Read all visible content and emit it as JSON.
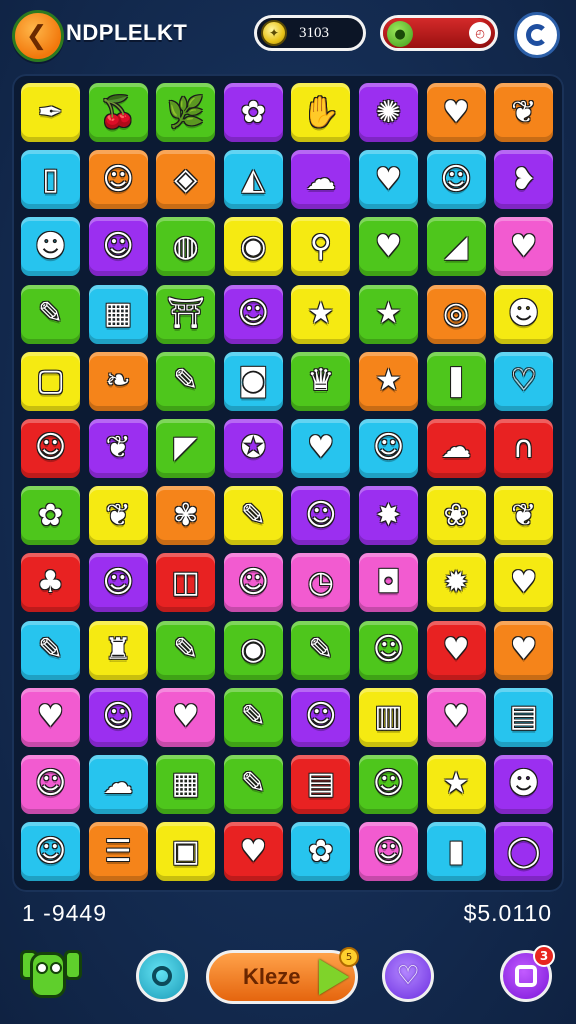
{
  "header": {
    "title": "NDPLELKT",
    "coins": "3103",
    "energy_level_percent": 95,
    "back_icon": "chevron-left-icon",
    "settings_icon": "settings-icon"
  },
  "board": {
    "columns": 8,
    "rows": 12,
    "palette": {
      "Y": "#f5ea12",
      "G": "#4ec61c",
      "P": "#9b2ff0",
      "O": "#f5841a",
      "C": "#27c4ee",
      "R": "#e82222",
      "K": "#f25bd0",
      "B": "#3a9cf0"
    },
    "tiles": [
      [
        {
          "c": "Y",
          "i": "✒"
        },
        {
          "c": "G",
          "i": "🍒"
        },
        {
          "c": "G",
          "i": "🌿"
        },
        {
          "c": "P",
          "i": "✿"
        },
        {
          "c": "Y",
          "i": "✋"
        },
        {
          "c": "P",
          "i": "✺"
        },
        {
          "c": "O",
          "i": "♥"
        },
        {
          "c": "O",
          "i": "❦"
        }
      ],
      [
        {
          "c": "C",
          "i": "▯"
        },
        {
          "c": "O",
          "i": "☺"
        },
        {
          "c": "O",
          "i": "◈"
        },
        {
          "c": "C",
          "i": "◭"
        },
        {
          "c": "P",
          "i": "☁"
        },
        {
          "c": "C",
          "i": "♥"
        },
        {
          "c": "C",
          "i": "☺"
        },
        {
          "c": "P",
          "i": "❥"
        }
      ],
      [
        {
          "c": "C",
          "i": "☻"
        },
        {
          "c": "P",
          "i": "☺"
        },
        {
          "c": "G",
          "i": "◍"
        },
        {
          "c": "Y",
          "i": "◉"
        },
        {
          "c": "Y",
          "i": "⚲"
        },
        {
          "c": "G",
          "i": "♥"
        },
        {
          "c": "G",
          "i": "◢"
        },
        {
          "c": "K",
          "i": "♥"
        }
      ],
      [
        {
          "c": "G",
          "i": "✎"
        },
        {
          "c": "C",
          "i": "▦"
        },
        {
          "c": "G",
          "i": "⛩"
        },
        {
          "c": "P",
          "i": "☺"
        },
        {
          "c": "Y",
          "i": "★"
        },
        {
          "c": "G",
          "i": "★"
        },
        {
          "c": "O",
          "i": "◎"
        },
        {
          "c": "Y",
          "i": "☻"
        }
      ],
      [
        {
          "c": "Y",
          "i": "▢"
        },
        {
          "c": "O",
          "i": "❧"
        },
        {
          "c": "G",
          "i": "✎"
        },
        {
          "c": "C",
          "i": "◙"
        },
        {
          "c": "G",
          "i": "♛"
        },
        {
          "c": "O",
          "i": "★"
        },
        {
          "c": "G",
          "i": "❚"
        },
        {
          "c": "C",
          "i": "♡"
        }
      ],
      [
        {
          "c": "R",
          "i": "☺"
        },
        {
          "c": "P",
          "i": "❦"
        },
        {
          "c": "G",
          "i": "◤"
        },
        {
          "c": "P",
          "i": "✪"
        },
        {
          "c": "C",
          "i": "♥"
        },
        {
          "c": "C",
          "i": "☺"
        },
        {
          "c": "R",
          "i": "☁"
        },
        {
          "c": "R",
          "i": "∩"
        }
      ],
      [
        {
          "c": "G",
          "i": "✿"
        },
        {
          "c": "Y",
          "i": "❦"
        },
        {
          "c": "O",
          "i": "✾"
        },
        {
          "c": "Y",
          "i": "✎"
        },
        {
          "c": "P",
          "i": "☺"
        },
        {
          "c": "P",
          "i": "✸"
        },
        {
          "c": "Y",
          "i": "❀"
        },
        {
          "c": "Y",
          "i": "❦"
        }
      ],
      [
        {
          "c": "R",
          "i": "♣"
        },
        {
          "c": "P",
          "i": "☺"
        },
        {
          "c": "R",
          "i": "◫"
        },
        {
          "c": "K",
          "i": "☺"
        },
        {
          "c": "K",
          "i": "◷"
        },
        {
          "c": "K",
          "i": "◘"
        },
        {
          "c": "Y",
          "i": "✹"
        },
        {
          "c": "Y",
          "i": "♥"
        }
      ],
      [
        {
          "c": "C",
          "i": "✎"
        },
        {
          "c": "Y",
          "i": "♜"
        },
        {
          "c": "G",
          "i": "✎"
        },
        {
          "c": "G",
          "i": "◉"
        },
        {
          "c": "G",
          "i": "✎"
        },
        {
          "c": "G",
          "i": "☺"
        },
        {
          "c": "R",
          "i": "♥"
        },
        {
          "c": "O",
          "i": "♥"
        }
      ],
      [
        {
          "c": "K",
          "i": "♥"
        },
        {
          "c": "P",
          "i": "☺"
        },
        {
          "c": "K",
          "i": "♥"
        },
        {
          "c": "G",
          "i": "✎"
        },
        {
          "c": "P",
          "i": "☺"
        },
        {
          "c": "Y",
          "i": "▥"
        },
        {
          "c": "K",
          "i": "♥"
        },
        {
          "c": "C",
          "i": "▤"
        }
      ],
      [
        {
          "c": "K",
          "i": "☺"
        },
        {
          "c": "C",
          "i": "☁"
        },
        {
          "c": "G",
          "i": "▦"
        },
        {
          "c": "G",
          "i": "✎"
        },
        {
          "c": "R",
          "i": "▤"
        },
        {
          "c": "G",
          "i": "☺"
        },
        {
          "c": "Y",
          "i": "★"
        },
        {
          "c": "P",
          "i": "☻"
        }
      ],
      [
        {
          "c": "C",
          "i": "☺"
        },
        {
          "c": "O",
          "i": "☰"
        },
        {
          "c": "Y",
          "i": "▣"
        },
        {
          "c": "R",
          "i": "♥"
        },
        {
          "c": "C",
          "i": "✿"
        },
        {
          "c": "K",
          "i": "☺"
        },
        {
          "c": "C",
          "i": "▮"
        },
        {
          "c": "P",
          "i": "◯"
        }
      ]
    ]
  },
  "footer": {
    "left_score": "1 -9449",
    "right_score": "$5.0110",
    "play_label": "Kleze",
    "play_badge": "5",
    "menu_badge": "3"
  }
}
